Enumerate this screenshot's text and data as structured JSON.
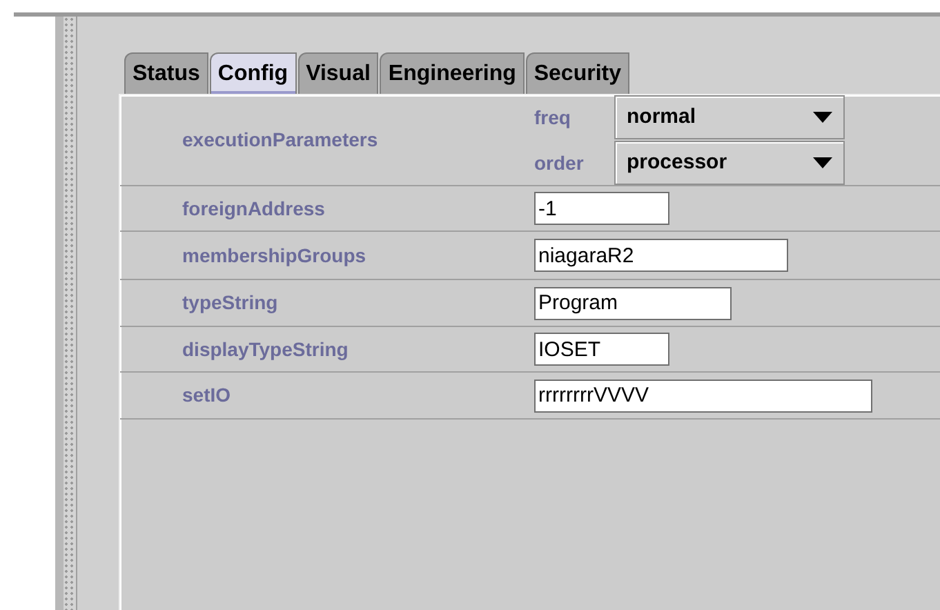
{
  "tabs": [
    {
      "label": "Status",
      "selected": false
    },
    {
      "label": "Config",
      "selected": true
    },
    {
      "label": "Visual",
      "selected": false
    },
    {
      "label": "Engineering",
      "selected": false
    },
    {
      "label": "Security",
      "selected": false
    }
  ],
  "properties": [
    {
      "kind": "choices",
      "name": "executionParameters",
      "choices": [
        {
          "label": "freq",
          "value": "normal"
        },
        {
          "label": "order",
          "value": "processor"
        }
      ]
    },
    {
      "kind": "text",
      "name": "foreignAddress",
      "value": "-1"
    },
    {
      "kind": "text",
      "name": "membershipGroups",
      "value": "niagaraR2"
    },
    {
      "kind": "text",
      "name": "typeString",
      "value": "Program"
    },
    {
      "kind": "text",
      "name": "displayTypeString",
      "value": "IOSET"
    },
    {
      "kind": "text",
      "name": "setIO",
      "value": "rrrrrrrrVVVV"
    }
  ]
}
